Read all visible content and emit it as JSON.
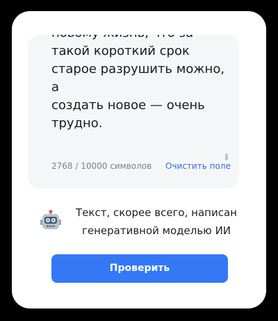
{
  "editor": {
    "text": "новому жизнь, что за\nтакой короткий срок\nстарое разрушить можно, а\nсоздать новое — очень\nтрудно.",
    "char_count": "2768 / 10000 символов",
    "clear_label": "Очистить поле"
  },
  "result": {
    "icon": "robot-icon",
    "line1": "Текст, скорее всего, написан",
    "line2": "генеративной моделью ИИ"
  },
  "actions": {
    "check_label": "Проверить"
  },
  "colors": {
    "background": "#000000",
    "card": "#ffffff",
    "editor_bg": "#f5f6f8",
    "accent": "#3478f6",
    "link": "#2f6fdb"
  }
}
